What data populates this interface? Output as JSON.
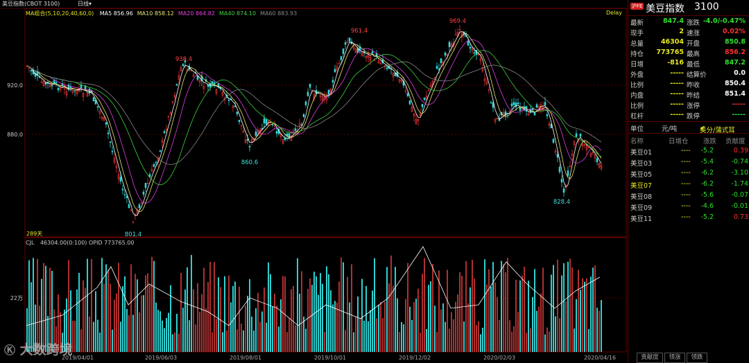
{
  "topbar": {
    "title": "美豆指数(CBOT 3100)",
    "period": "日线",
    "period_arrow": "▾"
  },
  "ma_legend": {
    "label": "MA组合(5,10,20,40,60,0)",
    "items": [
      {
        "text": "MA5 856.96",
        "color": "#ffffff"
      },
      {
        "text": "MA10 858.12",
        "color": "#e8e870"
      },
      {
        "text": "MA20 864.82",
        "color": "#e040e0"
      },
      {
        "text": "MA40 874.10",
        "color": "#40d040"
      },
      {
        "text": "MA60 883.93",
        "color": "#888888"
      }
    ],
    "delay": "Delay"
  },
  "price_axis": {
    "labels": [
      "920.0",
      "880.0"
    ]
  },
  "price_annotations": [
    {
      "text": "938.4",
      "color": "#ff4040"
    },
    {
      "text": "961.4",
      "color": "#ff4040"
    },
    {
      "text": "969.4",
      "color": "#ff4040"
    },
    {
      "text": "860.6",
      "color": "#40e0e0"
    },
    {
      "text": "801.4",
      "color": "#40e0e0"
    },
    {
      "text": "828.4",
      "color": "#40e0e0"
    }
  ],
  "days_label": "289天",
  "volume_legend": {
    "label": "CJL",
    "values": "46304.00(0:100)  OPID 773765.00"
  },
  "volume_axis": {
    "label": "22万"
  },
  "date_axis": [
    "2019/04/01",
    "2019/06/03",
    "2019/08/01",
    "2019/10/01",
    "2019/12/02",
    "2020/02/03",
    "2020/04/16"
  ],
  "watermark": "大数跨境",
  "colors": {
    "up": "#e03030",
    "down": "#30d8d8",
    "price_red": "#ff3030",
    "price_green": "#30e030",
    "yellow": "#e8e820"
  },
  "quote": {
    "badge": "沪FE",
    "name": "美豆指数",
    "code": "3100",
    "rows": [
      {
        "l1": "最新",
        "v1": "847.4",
        "c1": "#30e030",
        "l2": "涨跌",
        "v2": "-4.0/-0.47%",
        "c2": "#30e030"
      },
      {
        "l1": "现手",
        "v1": "2",
        "c1": "#e8e820",
        "l2": "速涨",
        "v2": "0.02%",
        "c2": "#ff3030"
      },
      {
        "l1": "总量",
        "v1": "46304",
        "c1": "#e8e820",
        "l2": "开盘",
        "v2": "850.8",
        "c2": "#30e030"
      },
      {
        "l1": "持仓",
        "v1": "773765",
        "c1": "#e8e820",
        "l2": "最高",
        "v2": "856.2",
        "c2": "#ff3030"
      },
      {
        "l1": "日增",
        "v1": "-816",
        "c1": "#e8e820",
        "l2": "最低",
        "v2": "847.2",
        "c2": "#30e030"
      },
      {
        "l1": "外盘",
        "v1": "-----",
        "c1": "#e8e820",
        "l2": "结算价",
        "v2": "0.0",
        "c2": "#ffffff"
      },
      {
        "l1": "比例",
        "v1": "-----",
        "c1": "#e8e820",
        "l2": "昨收",
        "v2": "850.4",
        "c2": "#ffffff"
      },
      {
        "l1": "内盘",
        "v1": "-----",
        "c1": "#e8e820",
        "l2": "昨结",
        "v2": "851.4",
        "c2": "#ffffff"
      },
      {
        "l1": "比例",
        "v1": "-----",
        "c1": "#e8e820",
        "l2": "涨停",
        "v2": "-----",
        "c2": "#ff3030"
      },
      {
        "l1": "杠杆",
        "v1": "-----",
        "c1": "#e8e820",
        "l2": "跌停",
        "v2": "-----",
        "c2": "#30e030"
      }
    ],
    "unit_label": "单位",
    "unit_value": "元/吨",
    "unit_option": "美分/蒲式耳",
    "table_headers": [
      "名称",
      "日增仓",
      "涨跌",
      "贡献度"
    ],
    "table_rows": [
      {
        "name": "美豆01",
        "inc": "----",
        "chg": "-5.2",
        "contrib": "0.39",
        "cc": "#ff3030",
        "nc": "#cccccc"
      },
      {
        "name": "美豆03",
        "inc": "----",
        "chg": "-5.4",
        "contrib": "-0.74",
        "cc": "#30e030",
        "nc": "#cccccc"
      },
      {
        "name": "美豆05",
        "inc": "----",
        "chg": "-6.2",
        "contrib": "-3.10",
        "cc": "#30e030",
        "nc": "#cccccc"
      },
      {
        "name": "美豆07",
        "inc": "----",
        "chg": "-6.2",
        "contrib": "-1.74",
        "cc": "#30e030",
        "nc": "#e8e820"
      },
      {
        "name": "美豆08",
        "inc": "----",
        "chg": "-5.6",
        "contrib": "-0.07",
        "cc": "#30e030",
        "nc": "#cccccc"
      },
      {
        "name": "美豆09",
        "inc": "----",
        "chg": "-4.6",
        "contrib": "-0.01",
        "cc": "#30e030",
        "nc": "#cccccc"
      },
      {
        "name": "美豆11",
        "inc": "----",
        "chg": "-5.2",
        "contrib": "0.73",
        "cc": "#ff3030",
        "nc": "#cccccc"
      }
    ],
    "bottom_tabs": [
      "贡献度",
      "领涨",
      "领跌"
    ]
  }
}
